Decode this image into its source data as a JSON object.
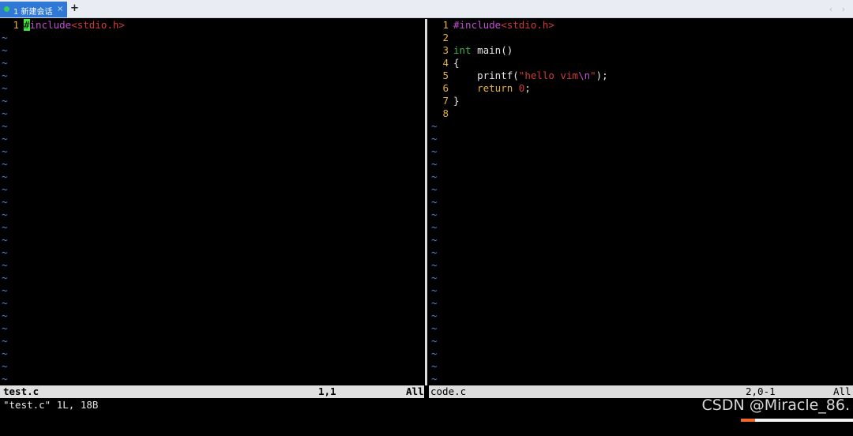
{
  "tabbar": {
    "tab_label": "1 新建会话",
    "close_glyph": "×",
    "new_tab_glyph": "+",
    "scroll_arrows": "‹ ›"
  },
  "left_pane": {
    "lines": [
      {
        "num": "1",
        "cursor": "#",
        "directive": "include",
        "header": "<stdio.h>"
      }
    ],
    "tilde": "~",
    "tilde_count": 28
  },
  "right_pane": {
    "lines": [
      {
        "num": "1"
      },
      {
        "num": "2"
      },
      {
        "num": "3"
      },
      {
        "num": "4"
      },
      {
        "num": "5"
      },
      {
        "num": "6"
      },
      {
        "num": "7"
      },
      {
        "num": "8"
      }
    ],
    "code": {
      "l1_directive": "#include",
      "l1_header": "<stdio.h>",
      "l3_type": "int",
      "l3_rest": " main()",
      "l4": "{",
      "l5_pre": "    printf(",
      "l5_str": "\"hello vim",
      "l5_esc": "\\n",
      "l5_strend": "\"",
      "l5_post": ");",
      "l6_kw": "    return",
      "l6_num": "0",
      "l6_post": ";",
      "l7": "}"
    },
    "tilde": "~",
    "tilde_count": 21
  },
  "statusbar": {
    "left_file": "test.c",
    "left_pos": "1,1",
    "left_scroll": "All",
    "right_file": "code.c",
    "right_pos": "2,0-1",
    "right_scroll": "All"
  },
  "cmdline": {
    "message": "\"test.c\" 1L, 18B"
  },
  "watermark": "CSDN @Miracle_86."
}
